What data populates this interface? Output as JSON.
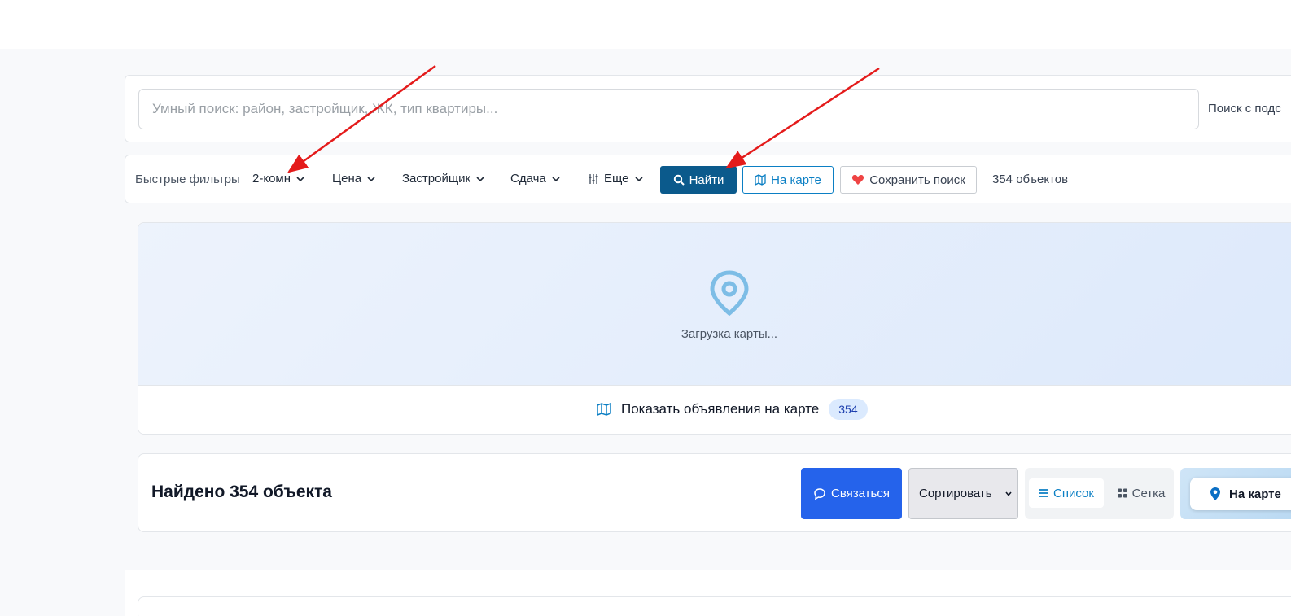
{
  "search": {
    "placeholder": "Умный поиск: район, застройщик, ЖК, тип квартиры...",
    "sub_label": "Поиск с подс"
  },
  "filters": {
    "quick_label": "Быстрые фильтры",
    "rooms": "2-комн",
    "price": "Цена",
    "developer": "Застройщик",
    "completion": "Сдача",
    "more": "Еще",
    "find_button": "Найти",
    "map_button": "На карте",
    "save_button": "Сохранить поиск",
    "count": "354 объектов"
  },
  "map": {
    "loading": "Загрузка карты...",
    "show_on_map": "Показать объявления на карте",
    "badge": "354"
  },
  "results": {
    "found": "Найдено 354 объекта",
    "contact_button": "Связаться",
    "sort_label": "Сортировать",
    "view_list": "Список",
    "view_grid": "Сетка",
    "map_button": "На карте"
  },
  "colors": {
    "primary": "#0b5a8c",
    "accent": "#0b7fc4",
    "contact": "#2563eb",
    "heart": "#ef4444",
    "annotation_arrow": "#e41b1b"
  },
  "icons": [
    "chevron-down-icon",
    "sliders-icon",
    "search-icon",
    "map-icon",
    "heart-icon",
    "map-pin-icon",
    "chat-icon",
    "list-icon",
    "grid-icon",
    "location-icon"
  ]
}
